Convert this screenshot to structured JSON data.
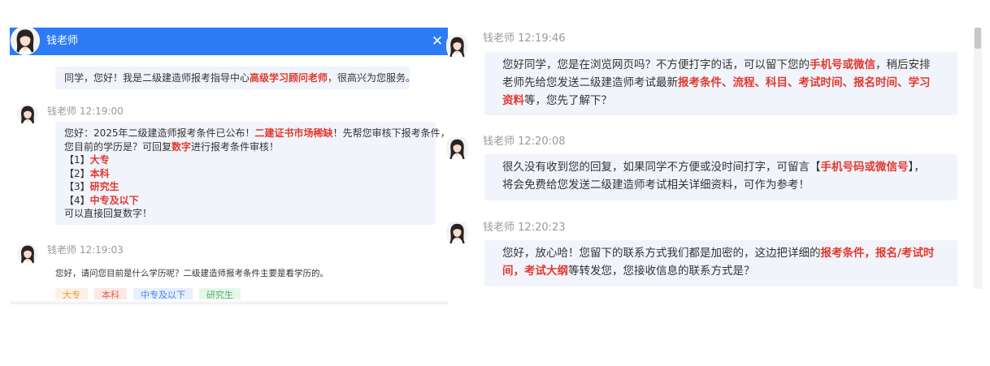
{
  "left_panel": {
    "header": {
      "name": "钱老师"
    },
    "messages": [
      {
        "segments": [
          {
            "t": "同学，您好！我是二级建造师报考指导中心",
            "hl": false
          },
          {
            "t": "高级学习顾问老师",
            "hl": true
          },
          {
            "t": "，很高兴为您服务。",
            "hl": false
          }
        ]
      },
      {
        "sender": "钱老师",
        "time": "12:19:00",
        "lines": [
          [
            {
              "t": "您好：2025年二级建造师报考条件已公布！",
              "hl": false
            },
            {
              "t": "二建证书市场稀缺",
              "hl": true
            },
            {
              "t": "！先帮您审核下报考条件，",
              "hl": false
            }
          ],
          [
            {
              "t": "您目前的学历是？可回复",
              "hl": false
            },
            {
              "t": "数字",
              "hl": true
            },
            {
              "t": "进行报考条件审核！",
              "hl": false
            }
          ],
          [
            {
              "t": "【1】",
              "hl": false
            },
            {
              "t": "大专",
              "hl": true
            }
          ],
          [
            {
              "t": "【2】",
              "hl": false
            },
            {
              "t": "本科",
              "hl": true
            }
          ],
          [
            {
              "t": "【3】",
              "hl": false
            },
            {
              "t": "研究生",
              "hl": true
            }
          ],
          [
            {
              "t": "【4】",
              "hl": false
            },
            {
              "t": "中专及以下",
              "hl": true
            }
          ],
          [
            {
              "t": "可以直接回复数字！",
              "hl": false
            }
          ]
        ]
      },
      {
        "sender": "钱老师",
        "time": "12:19:03",
        "text": "您好，请问您目前是什么学历呢？二级建造师报考条件主要是看学历的。",
        "options": [
          "大专",
          "本科",
          "中专及以下",
          "研究生"
        ]
      }
    ]
  },
  "right_panel": {
    "messages": [
      {
        "sender": "钱老师",
        "time": "12:19:46",
        "lines": [
          [
            {
              "t": "您好同学，您是在浏览网页吗？不方便打字的话，可以留下您的",
              "hl": false
            },
            {
              "t": "手机号或微信",
              "hl": true
            },
            {
              "t": "，稍后安排",
              "hl": false
            }
          ],
          [
            {
              "t": "老师先给您发送二级建造师考试最新",
              "hl": false
            },
            {
              "t": "报考条件、流程、科目、考试时间、报名时间、学习",
              "hl": true
            }
          ],
          [
            {
              "t": "资料",
              "hl": true
            },
            {
              "t": "等，您先了解下？",
              "hl": false
            }
          ]
        ]
      },
      {
        "sender": "钱老师",
        "time": "12:20:08",
        "lines": [
          [
            {
              "t": "很久没有收到您的回复，如果同学不方便或没时间打字，可留言【",
              "hl": false
            },
            {
              "t": "手机号码或微信号",
              "hl": true
            },
            {
              "t": "】，",
              "hl": false
            }
          ],
          [
            {
              "t": "将会免费给您发送二级建造师考试相关详细资料，可作为参考！",
              "hl": false
            }
          ]
        ]
      },
      {
        "sender": "钱老师",
        "time": "12:20:23",
        "lines": [
          [
            {
              "t": "您好，放心哈！您留下的联系方式我们都是加密的，这边把详细的",
              "hl": false
            },
            {
              "t": "报考条件，报名/考试时",
              "hl": true
            }
          ],
          [
            {
              "t": "间，考试大纲",
              "hl": true
            },
            {
              "t": "等转发您，您接收信息的联系方式是？",
              "hl": false
            }
          ]
        ]
      }
    ]
  },
  "colors": {
    "header_bg": "#2d7cf6",
    "highlight": "#e03a2f",
    "bubble_bg": "#f1f4fb"
  },
  "icons": {
    "close": "close-icon",
    "avatar": "teacher-avatar"
  }
}
